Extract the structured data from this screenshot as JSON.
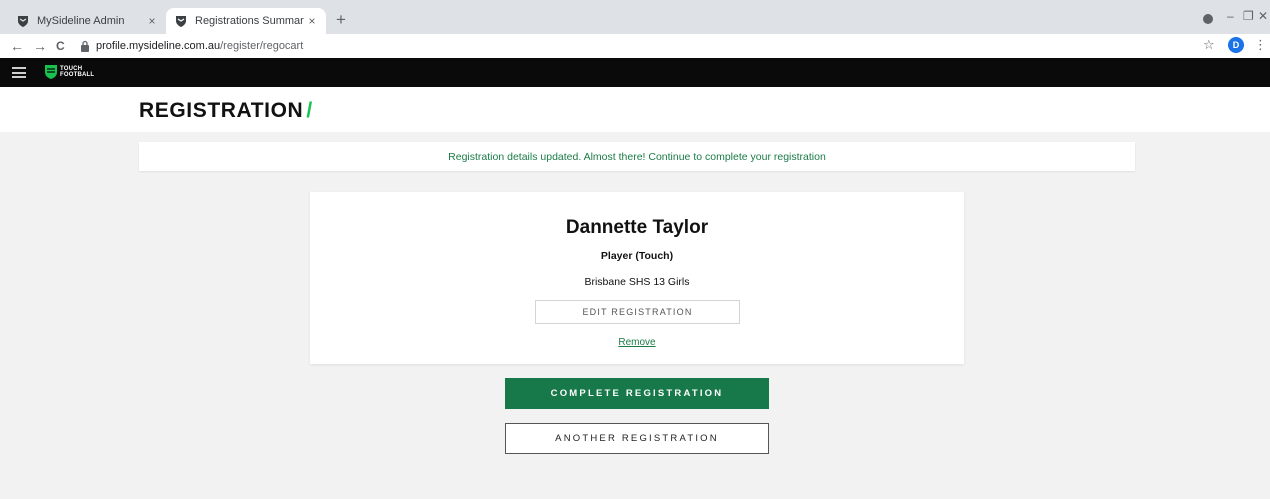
{
  "browser": {
    "tabs": [
      {
        "title": "MySideline Admin",
        "active": false,
        "close": "×"
      },
      {
        "title": "Registrations Summary – MySide",
        "active": true,
        "close": "×"
      }
    ],
    "new_tab": "+",
    "url_host": "profile.mysideline.com.au",
    "url_path": "/register/regocart",
    "profile_initial": "D",
    "nav": {
      "back": "←",
      "forward": "→",
      "reload": "C"
    },
    "star": "☆",
    "menu": "⋮",
    "window": {
      "minimize": "–",
      "restore": "❐",
      "close": "✕"
    }
  },
  "app": {
    "brand_line1": "TOUCH",
    "brand_line2": "FOOTBALL",
    "brand_color": "#19c24e"
  },
  "page": {
    "title": "REGISTRATION",
    "title_suffix": "/",
    "notice": "Registration details updated. Almost there! Continue to complete your registration"
  },
  "registration": {
    "name": "Dannette Taylor",
    "role": "Player (Touch)",
    "team": "Brisbane SHS 13 Girls",
    "edit_label": "EDIT REGISTRATION",
    "remove_label": "Remove"
  },
  "actions": {
    "complete_label": "COMPLETE REGISTRATION",
    "another_label": "ANOTHER REGISTRATION",
    "accent_color": "#17784a"
  },
  "icons": {
    "tab_favicon": "shield-icon",
    "lock": "lock-icon",
    "menu": "hamburger-icon"
  }
}
